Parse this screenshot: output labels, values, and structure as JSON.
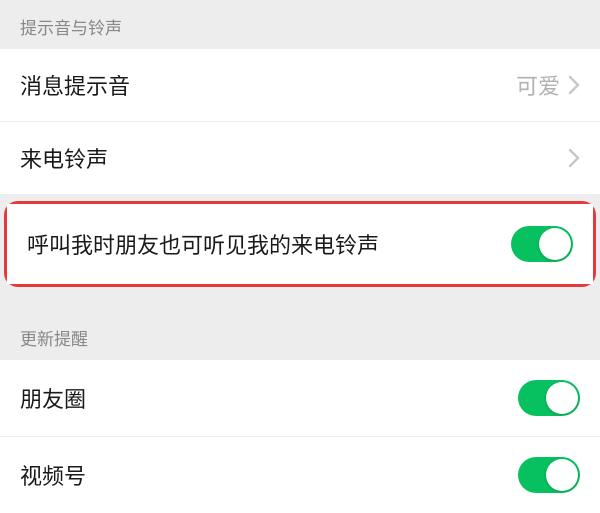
{
  "sections": {
    "sound": {
      "header": "提示音与铃声",
      "rows": {
        "messageSound": {
          "label": "消息提示音",
          "value": "可爱"
        },
        "ringtone": {
          "label": "来电铃声"
        },
        "friendsHearRingtone": {
          "label": "呼叫我时朋友也可听见我的来电铃声",
          "toggle": true
        }
      }
    },
    "updates": {
      "header": "更新提醒",
      "rows": {
        "moments": {
          "label": "朋友圈",
          "toggle": true
        },
        "channels": {
          "label": "视频号",
          "toggle": true
        }
      }
    }
  }
}
